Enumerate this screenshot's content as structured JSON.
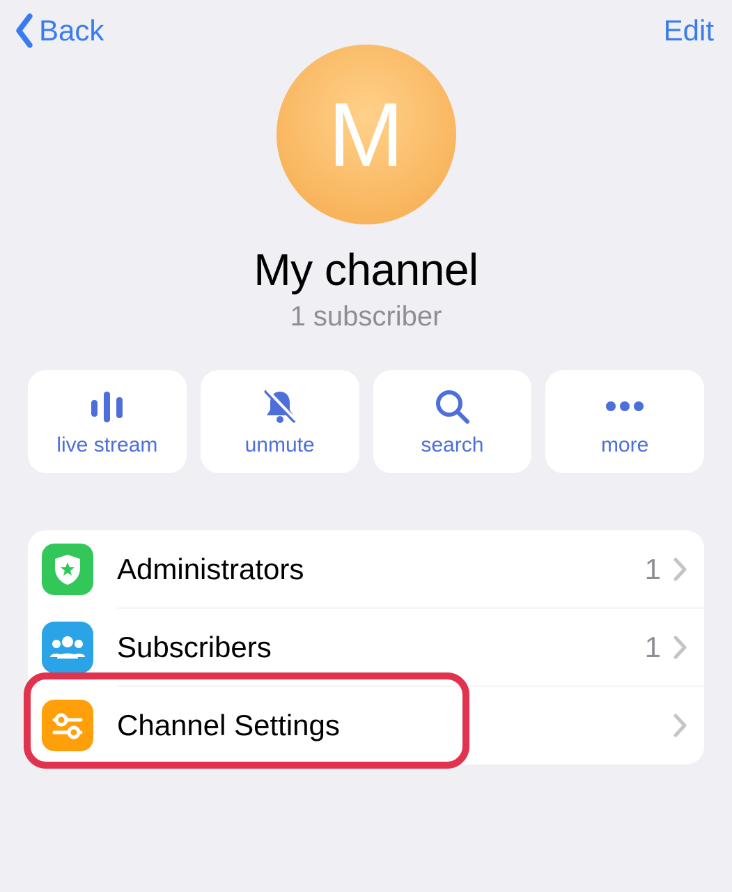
{
  "nav": {
    "back_label": "Back",
    "edit_label": "Edit"
  },
  "channel": {
    "avatar_letter": "M",
    "name": "My channel",
    "subscriber_text": "1 subscriber"
  },
  "actions": {
    "live_stream": "live stream",
    "unmute": "unmute",
    "search": "search",
    "more": "more"
  },
  "rows": {
    "administrators": {
      "label": "Administrators",
      "count": "1"
    },
    "subscribers": {
      "label": "Subscribers",
      "count": "1"
    },
    "settings": {
      "label": "Channel Settings"
    }
  }
}
